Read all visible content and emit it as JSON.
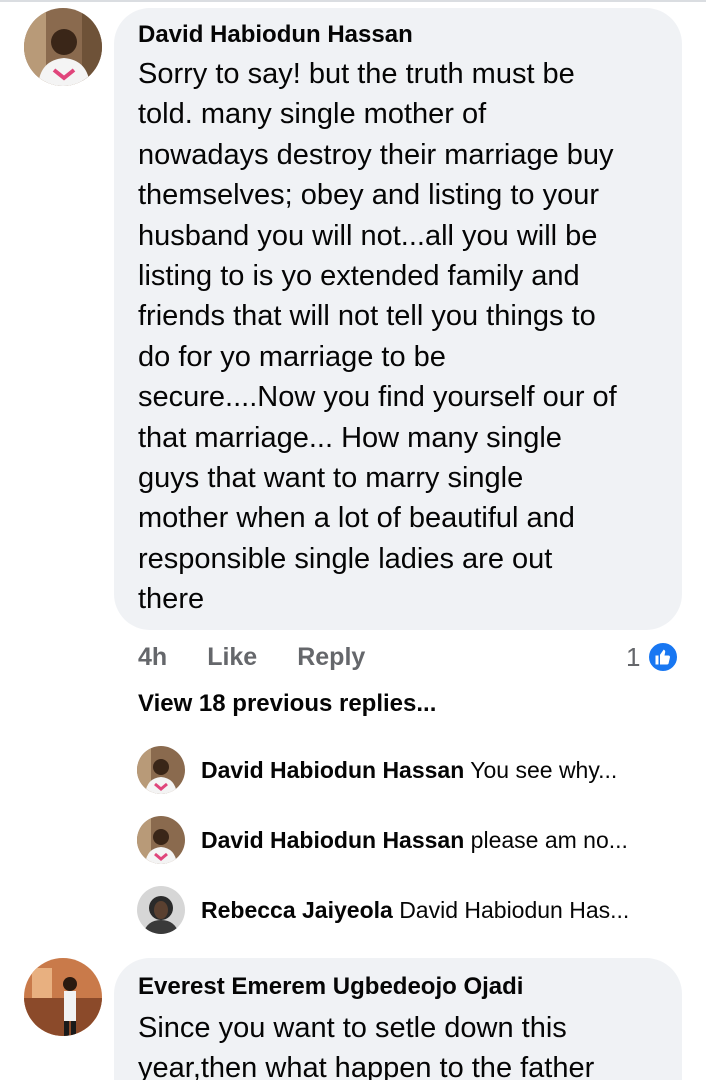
{
  "comment1": {
    "author": "David Habiodun Hassan",
    "text": "Sorry to say! but the truth must be\ntold. many single mother of\nnowadays destroy their marriage buy\nthemselves; obey and listing to your\nhusband you will not...all you will be\nlisting to is yo extended family and\nfriends that will not tell you things to\ndo for yo marriage to be\nsecure....Now you find yourself our of\nthat marriage... How many single\nguys that want to marry single\nmother when a lot of beautiful and\nresponsible single ladies are out\nthere",
    "time": "4h",
    "like_label": "Like",
    "reply_label": "Reply",
    "reaction_count": "1",
    "reaction_icon": "thumbs-up-icon",
    "accent_color": "#1877f2"
  },
  "view_previous": "View 18 previous replies...",
  "replies": [
    {
      "author": "David Habiodun Hassan",
      "snippet": "You see why..."
    },
    {
      "author": "David Habiodun Hassan",
      "snippet": "please am no..."
    },
    {
      "author": "Rebecca Jaiyeola",
      "snippet": "David Habiodun Has..."
    }
  ],
  "comment2": {
    "author": "Everest Emerem Ugbedeojo Ojadi",
    "text": "Since you want to setle down this\nyear,then what happen to the father"
  }
}
